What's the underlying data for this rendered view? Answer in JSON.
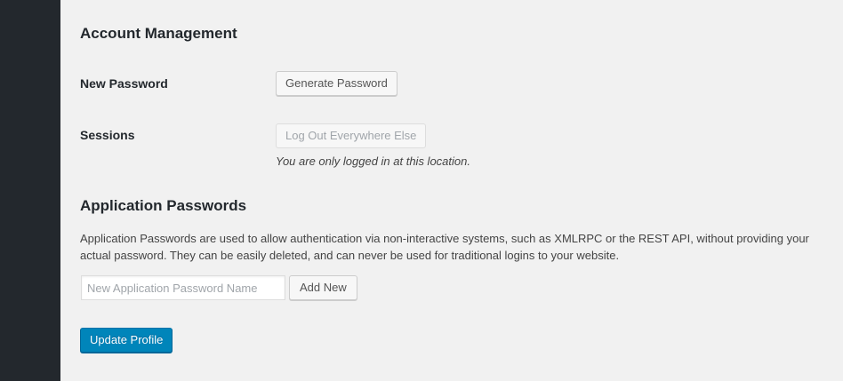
{
  "account_management": {
    "heading": "Account Management",
    "new_password": {
      "label": "New Password",
      "button": "Generate Password"
    },
    "sessions": {
      "label": "Sessions",
      "button": "Log Out Everywhere Else",
      "note": "You are only logged in at this location."
    }
  },
  "application_passwords": {
    "heading": "Application Passwords",
    "description": "Application Passwords are used to allow authentication via non-interactive systems, such as XMLRPC or the REST API, without providing your actual password. They can be easily deleted, and can never be used for traditional logins to your website.",
    "input_placeholder": "New Application Password Name",
    "input_value": "",
    "add_button": "Add New"
  },
  "submit": {
    "label": "Update Profile"
  },
  "colors": {
    "sidebar": "#23282d",
    "background": "#f1f1f1",
    "primary": "#0085ba"
  }
}
